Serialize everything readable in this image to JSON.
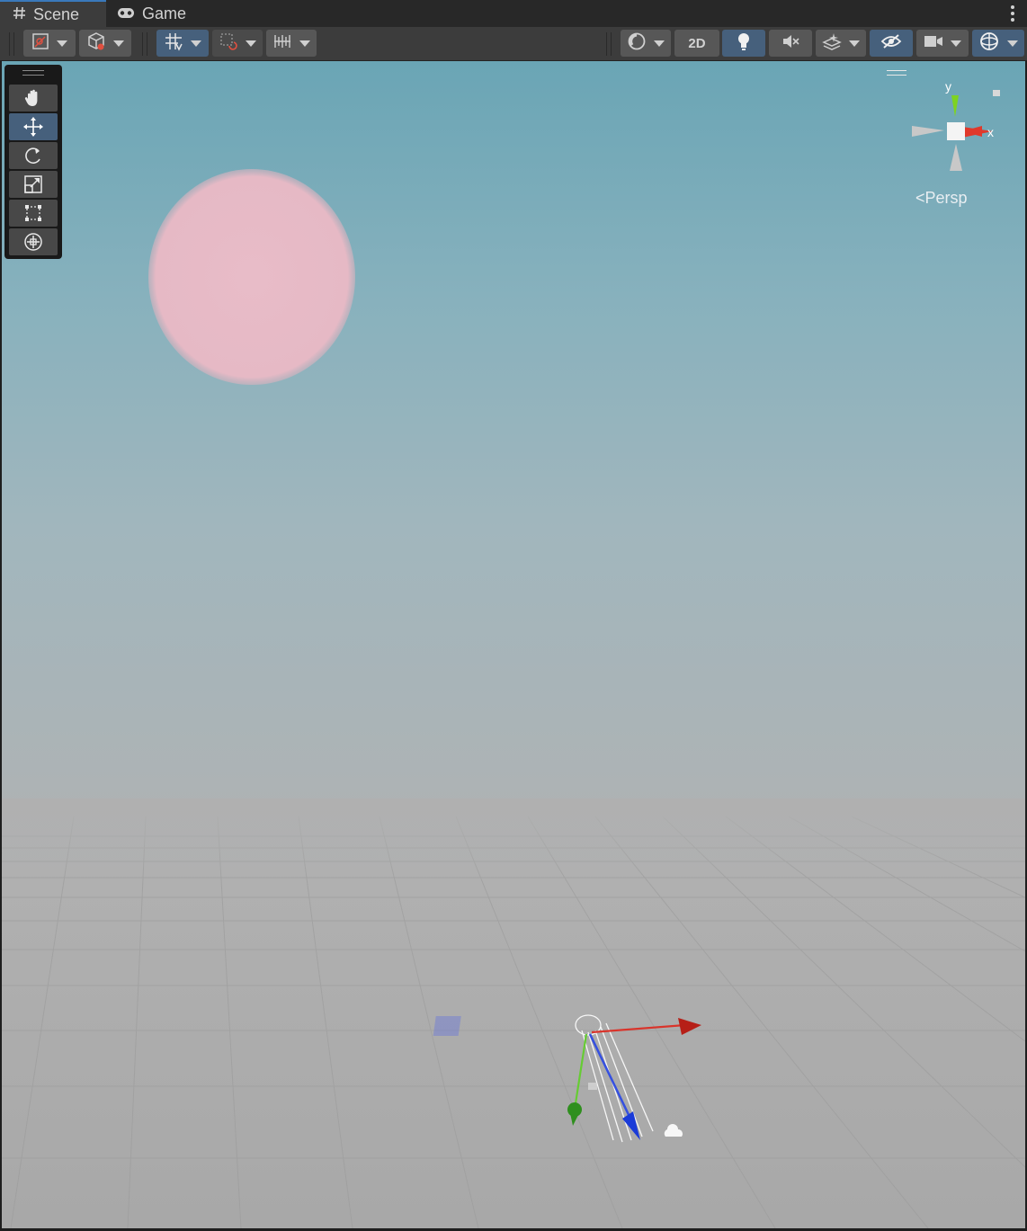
{
  "tabs": [
    {
      "label": "Scene",
      "icon": "hash-icon"
    },
    {
      "label": "Game",
      "icon": "gamepad-icon"
    }
  ],
  "toolbar": {
    "view_2d_label": "2D",
    "toggles": {
      "grid_snapping": true,
      "lighting": true,
      "audio": false,
      "scene_visibility": true,
      "gizmos": true
    }
  },
  "tools_overlay": {
    "items": [
      {
        "name": "view-tool",
        "icon": "hand-icon",
        "active": false
      },
      {
        "name": "move-tool",
        "icon": "move-arrows-icon",
        "active": true
      },
      {
        "name": "rotate-tool",
        "icon": "rotate-icon",
        "active": false
      },
      {
        "name": "scale-tool",
        "icon": "scale-icon",
        "active": false
      },
      {
        "name": "rect-tool",
        "icon": "rect-transform-icon",
        "active": false
      },
      {
        "name": "transform-tool",
        "icon": "transform-icon",
        "active": false
      }
    ]
  },
  "orientation_gizmo": {
    "y_label": "y",
    "x_label": "x",
    "projection_label": "Persp"
  },
  "colors": {
    "accent_active": "#46607c",
    "axis_x": "#e0392b",
    "axis_y": "#7ed321",
    "axis_z": "#2b5bde",
    "sun_disc": "#e8b9c6"
  }
}
